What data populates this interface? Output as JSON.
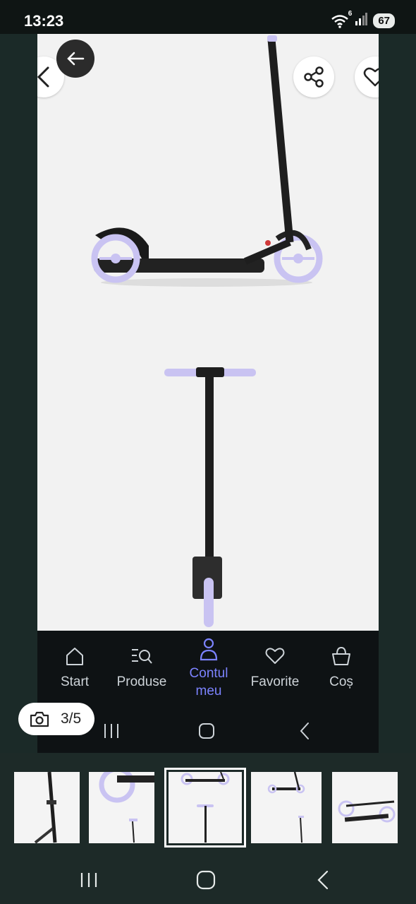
{
  "status": {
    "time": "13:23",
    "battery": "67",
    "signal_badge": "6"
  },
  "bottom_tabs": [
    {
      "label": "Start",
      "icon": "home-icon",
      "active": false
    },
    {
      "label": "Produse",
      "icon": "search-list-icon",
      "active": false
    },
    {
      "label": "Contul\nmeu",
      "icon": "user-icon",
      "active": true
    },
    {
      "label": "Favorite",
      "icon": "heart-icon",
      "active": false
    },
    {
      "label": "Coș",
      "icon": "basket-icon",
      "active": false
    }
  ],
  "gallery": {
    "counter": "3/5",
    "selected_index": 2,
    "total": 5
  },
  "colors": {
    "accent": "#7c83ff",
    "wheel": "#c9c3f2",
    "background": "#182221"
  }
}
